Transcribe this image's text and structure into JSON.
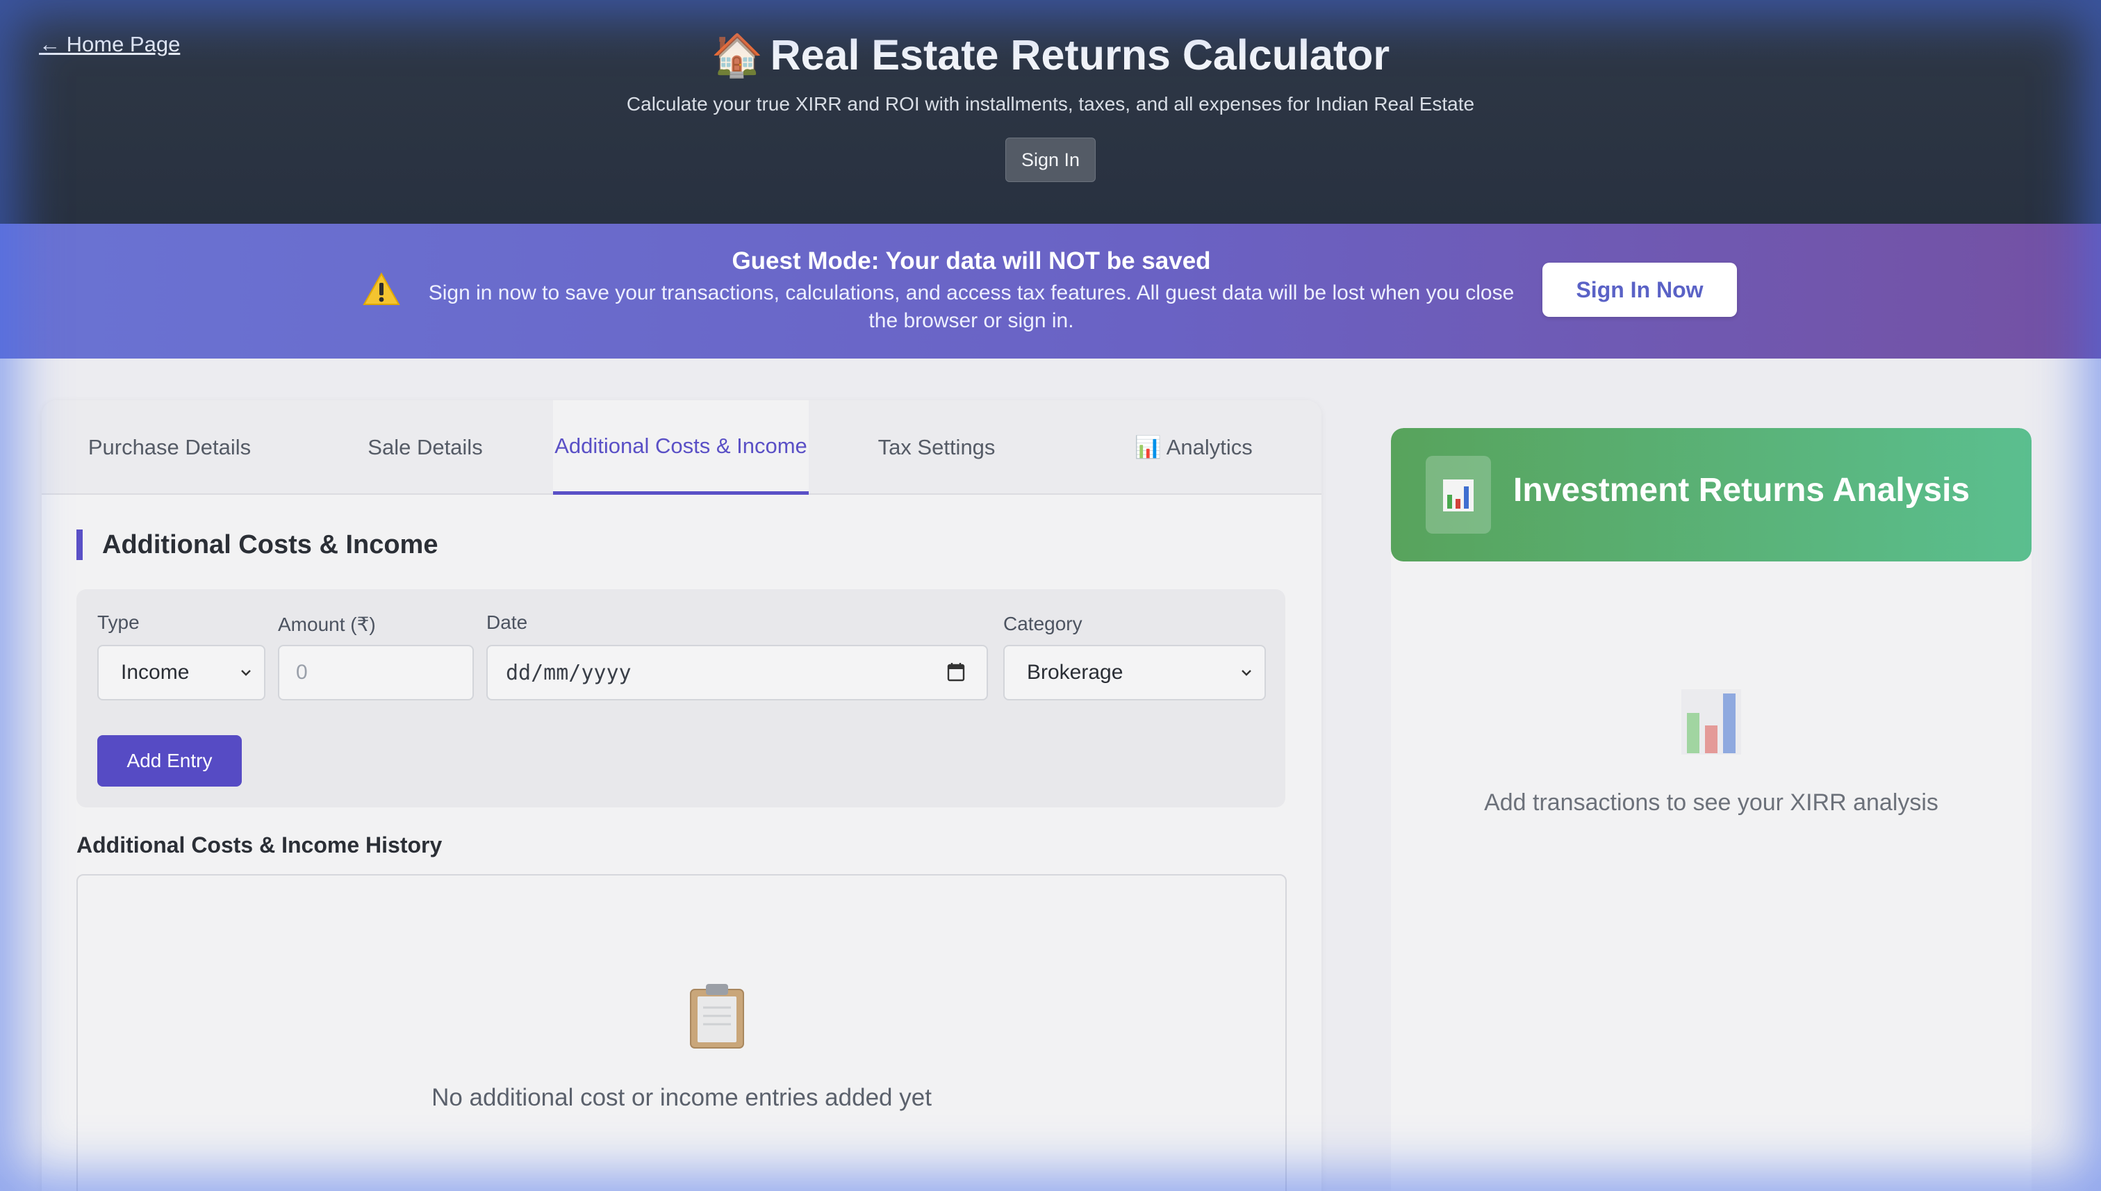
{
  "header": {
    "home_link": "← Home Page",
    "title_emoji": "🏠",
    "title": "Real Estate Returns Calculator",
    "subtitle": "Calculate your true XIRR and ROI with installments, taxes, and all expenses for Indian Real Estate",
    "sign_in": "Sign In"
  },
  "banner": {
    "icon": "warning-icon",
    "title": "Guest Mode: Your data will NOT be saved",
    "text": "Sign in now to save your transactions, calculations, and access tax features. All guest data will be lost when you close the browser or sign in.",
    "button": "Sign In Now"
  },
  "tabs": [
    {
      "label": "Purchase Details",
      "active": false
    },
    {
      "label": "Sale Details",
      "active": false
    },
    {
      "label": "Additional Costs & Income",
      "active": true
    },
    {
      "label": "Tax Settings",
      "active": false
    },
    {
      "label": "📊 Analytics",
      "active": false
    }
  ],
  "form": {
    "heading": "Additional Costs & Income",
    "type_label": "Type",
    "type_value": "Income",
    "amount_label": "Amount (₹)",
    "amount_placeholder": "0",
    "date_label": "Date",
    "date_placeholder": "dd/mm/yyyy",
    "category_label": "Category",
    "category_value": "Brokerage",
    "add_button": "Add Entry"
  },
  "history": {
    "heading": "Additional Costs & Income History",
    "empty_icon": "clipboard-icon",
    "empty_text": "No additional cost or income entries added yet"
  },
  "analysis": {
    "icon": "bar-chart-icon",
    "title": "Investment Returns Analysis",
    "empty_text": "Add transactions to see your XIRR analysis"
  },
  "colors": {
    "accent": "#5a50c6",
    "header_bg": "#2f3846",
    "banner_start": "#6a73d3",
    "banner_end": "#7451a3",
    "analysis_start": "#58a35c",
    "analysis_end": "#5bbf8f"
  }
}
